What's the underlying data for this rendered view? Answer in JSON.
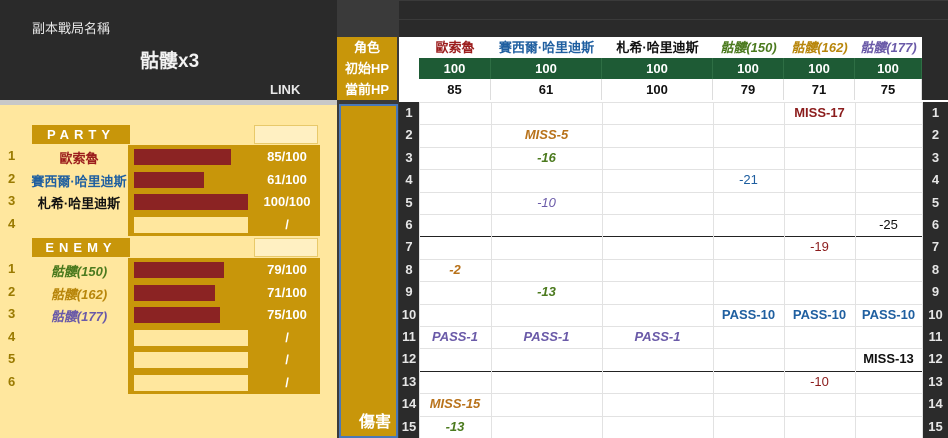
{
  "header": {
    "instance_label": "副本戰局名稱",
    "instance_name": "骷髏x3",
    "link_label": "LINK"
  },
  "row_labels": {
    "role": "角色",
    "init_hp": "初始HP",
    "cur_hp": "當前HP",
    "damage": "傷害"
  },
  "columns": [
    {
      "name": "歐索魯",
      "color": "#9b1c1c",
      "style": "normal",
      "init_hp": "100",
      "cur_hp": "85"
    },
    {
      "name": "賽西爾·哈里迪斯",
      "color": "#1f5fa0",
      "style": "normal",
      "init_hp": "100",
      "cur_hp": "61"
    },
    {
      "name": "札希·哈里迪斯",
      "color": "#111111",
      "style": "normal",
      "init_hp": "100",
      "cur_hp": "100"
    },
    {
      "name": "骷髏(150)",
      "color": "#4b7a1e",
      "style": "italic",
      "init_hp": "100",
      "cur_hp": "79"
    },
    {
      "name": "骷髏(162)",
      "color": "#b8860b",
      "style": "italic",
      "init_hp": "100",
      "cur_hp": "71"
    },
    {
      "name": "骷髏(177)",
      "color": "#6a5aa8",
      "style": "italic",
      "init_hp": "100",
      "cur_hp": "75"
    }
  ],
  "party": {
    "title": "PARTY",
    "members": [
      {
        "idx": "1",
        "name": "歐索魯",
        "color": "#9b1c1c",
        "style": "normal",
        "hp_text": "85/100",
        "hp_fraction": 0.85
      },
      {
        "idx": "2",
        "name": "賽西爾·哈里迪斯",
        "color": "#1f5fa0",
        "style": "normal",
        "hp_text": "61/100",
        "hp_fraction": 0.61
      },
      {
        "idx": "3",
        "name": "札希·哈里迪斯",
        "color": "#111111",
        "style": "normal",
        "hp_text": "100/100",
        "hp_fraction": 1.0
      },
      {
        "idx": "4",
        "name": "",
        "color": "#111111",
        "style": "normal",
        "hp_text": "/",
        "hp_fraction": 0
      }
    ]
  },
  "enemy": {
    "title": "ENEMY",
    "members": [
      {
        "idx": "1",
        "name": "骷髏(150)",
        "color": "#4b7a1e",
        "style": "italic",
        "hp_text": "79/100",
        "hp_fraction": 0.79
      },
      {
        "idx": "2",
        "name": "骷髏(162)",
        "color": "#b8860b",
        "style": "italic",
        "hp_text": "71/100",
        "hp_fraction": 0.71
      },
      {
        "idx": "3",
        "name": "骷髏(177)",
        "color": "#6a5aa8",
        "style": "italic",
        "hp_text": "75/100",
        "hp_fraction": 0.75
      },
      {
        "idx": "4",
        "name": "",
        "color": "#111111",
        "style": "normal",
        "hp_text": "/",
        "hp_fraction": 0
      },
      {
        "idx": "5",
        "name": "",
        "color": "#111111",
        "style": "normal",
        "hp_text": "/",
        "hp_fraction": 0
      },
      {
        "idx": "6",
        "name": "",
        "color": "#111111",
        "style": "normal",
        "hp_text": "/",
        "hp_fraction": 0
      }
    ]
  },
  "log_rows": [
    {
      "n": "1",
      "cells": [
        "",
        "",
        "",
        "",
        "MISS-17",
        ""
      ]
    },
    {
      "n": "2",
      "cells": [
        "",
        "MISS-5",
        "",
        "",
        "",
        ""
      ]
    },
    {
      "n": "3",
      "cells": [
        "",
        "-16",
        "",
        "",
        "",
        ""
      ]
    },
    {
      "n": "4",
      "cells": [
        "",
        "",
        "",
        "-21",
        "",
        ""
      ]
    },
    {
      "n": "5",
      "cells": [
        "",
        "-10",
        "",
        "",
        "",
        ""
      ]
    },
    {
      "n": "6",
      "cells": [
        "",
        "",
        "",
        "",
        "",
        "-25"
      ]
    },
    {
      "n": "7",
      "cells": [
        "",
        "",
        "",
        "",
        "-19",
        ""
      ]
    },
    {
      "n": "8",
      "cells": [
        "-2",
        "",
        "",
        "",
        "",
        ""
      ]
    },
    {
      "n": "9",
      "cells": [
        "",
        "-13",
        "",
        "",
        "",
        ""
      ]
    },
    {
      "n": "10",
      "cells": [
        "",
        "",
        "",
        "PASS-10",
        "PASS-10",
        "PASS-10"
      ]
    },
    {
      "n": "11",
      "cells": [
        "PASS-1",
        "PASS-1",
        "PASS-1",
        "",
        "",
        ""
      ]
    },
    {
      "n": "12",
      "cells": [
        "",
        "",
        "",
        "",
        "",
        "MISS-13"
      ]
    },
    {
      "n": "13",
      "cells": [
        "",
        "",
        "",
        "",
        "-10",
        ""
      ]
    },
    {
      "n": "14",
      "cells": [
        "MISS-15",
        "",
        "",
        "",
        "",
        ""
      ]
    },
    {
      "n": "15",
      "cells": [
        "-13",
        "",
        "",
        "",
        "",
        ""
      ]
    }
  ],
  "log_styles": {
    "1-4": {
      "color": "#8b1c1c",
      "italic": false,
      "bold": true
    },
    "2-1": {
      "color": "#b8721a",
      "italic": true,
      "bold": true
    },
    "3-1": {
      "color": "#4b7a1e",
      "italic": true,
      "bold": true
    },
    "4-3": {
      "color": "#1f5fa0",
      "italic": false,
      "bold": false
    },
    "5-1": {
      "color": "#6a5aa8",
      "italic": true,
      "bold": false
    },
    "6-5": {
      "color": "#111111",
      "italic": false,
      "bold": false
    },
    "7-4": {
      "color": "#8b1c1c",
      "italic": false,
      "bold": false
    },
    "8-0": {
      "color": "#b8721a",
      "italic": true,
      "bold": true
    },
    "9-1": {
      "color": "#4b7a1e",
      "italic": true,
      "bold": true
    },
    "10-3": {
      "color": "#1f5fa0",
      "italic": false,
      "bold": true
    },
    "10-4": {
      "color": "#1f5fa0",
      "italic": false,
      "bold": true
    },
    "10-5": {
      "color": "#1f5fa0",
      "italic": false,
      "bold": true
    },
    "11-0": {
      "color": "#6a5aa8",
      "italic": true,
      "bold": true
    },
    "11-1": {
      "color": "#6a5aa8",
      "italic": true,
      "bold": true
    },
    "11-2": {
      "color": "#6a5aa8",
      "italic": true,
      "bold": true
    },
    "12-5": {
      "color": "#111111",
      "italic": false,
      "bold": true
    },
    "13-4": {
      "color": "#8b1c1c",
      "italic": false,
      "bold": false
    },
    "14-0": {
      "color": "#b8721a",
      "italic": true,
      "bold": true
    },
    "15-0": {
      "color": "#4b7a1e",
      "italic": true,
      "bold": true
    }
  },
  "separator_after_rows": [
    "6",
    "12"
  ]
}
